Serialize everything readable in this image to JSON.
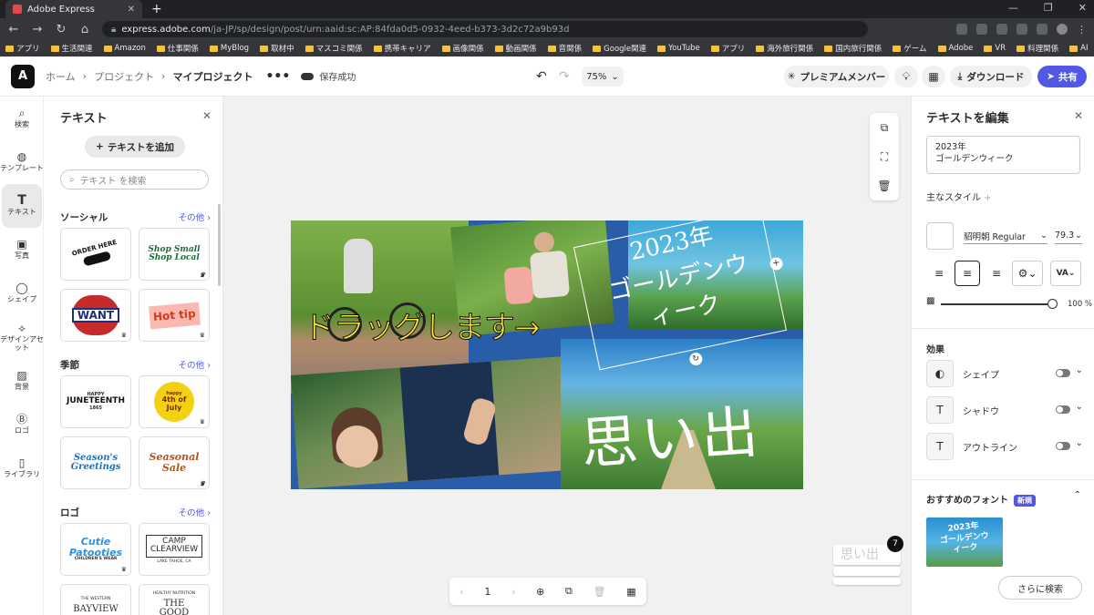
{
  "browser": {
    "tab_title": "Adobe Express",
    "url_host": "express.adobe.com",
    "url_path": "/ja-JP/sp/design/post/urn:aaid:sc:AP:84fda0d5-0932-4eed-b373-3d2c72a9b93d",
    "bookmarks": [
      "アプリ",
      "生活関連",
      "Amazon",
      "仕事関係",
      "MyBlog",
      "取材中",
      "マスコミ関係",
      "携帯キャリア",
      "画像関係",
      "動画関係",
      "音関係",
      "Google関連",
      "YouTube",
      "アプリ",
      "海外旅行関係",
      "国内旅行関係",
      "ゲーム",
      "Adobe",
      "VR",
      "料理関係",
      "AI"
    ]
  },
  "topbar": {
    "breadcrumb_home": "ホーム",
    "breadcrumb_projects": "プロジェクト",
    "breadcrumb_current": "マイプロジェクト",
    "more": "•••",
    "saved_status": "保存成功",
    "zoom": "75%",
    "premium": "プレミアムメンバー",
    "download": "ダウンロード",
    "share": "共有"
  },
  "rail": [
    {
      "icon": "search-icon",
      "label": "検索"
    },
    {
      "icon": "template-icon",
      "label": "テンプレート"
    },
    {
      "icon": "text-icon",
      "label": "テキスト"
    },
    {
      "icon": "photo-icon",
      "label": "写真"
    },
    {
      "icon": "shape-icon",
      "label": "シェイプ"
    },
    {
      "icon": "design-asset-icon",
      "label": "デザインアセット"
    },
    {
      "icon": "background-icon",
      "label": "背景"
    },
    {
      "icon": "logo-icon",
      "label": "ロゴ"
    },
    {
      "icon": "library-icon",
      "label": "ライブラリ"
    }
  ],
  "text_panel": {
    "title": "テキスト",
    "add_text": "テキストを追加",
    "search_placeholder": "テキスト を検索",
    "sections": [
      {
        "title": "ソーシャル",
        "more": "その他 ›"
      },
      {
        "title": "季節",
        "more": "その他 ›"
      },
      {
        "title": "ロゴ",
        "more": "その他 ›"
      }
    ],
    "thumbs": {
      "order_here": "ORDER HERE",
      "shop_small": "Shop Small Shop Local",
      "want": "WANT",
      "hot_tip": "Hot tip",
      "juneteenth_top": "HAPPY",
      "juneteenth": "JUNETEENTH",
      "juneteenth_year": "1865",
      "fourth_top": "happy",
      "fourth": "4th of July",
      "seasons": "Season's Greetings",
      "seasonal_sale": "Seasonal Sale",
      "cutie": "Cutie Patooties",
      "cutie_sub": "CHILDREN'S WEAR",
      "camp": "CAMP CLEARVIEW",
      "camp_sub": "LAKE TAHOE, CA",
      "western_top": "THE WESTERN",
      "bayview": "BAYVIEW",
      "good_food_top": "HEALTHY NUTRITION",
      "good_food": "THE GOOD FOOD"
    }
  },
  "canvas": {
    "headline_year": "2023年",
    "headline_main": "ゴールデンウ",
    "headline_tail": "ィーク",
    "memory": "思い出",
    "overlay": "ドラッグします→",
    "page_number": "1",
    "page_count": "7",
    "page_thumb_text": "思い出"
  },
  "right_panel": {
    "title": "テキストを編集",
    "text_value_line1": "2023年",
    "text_value_line2": "ゴールデンウィーク",
    "main_style": "主なスタイル",
    "font_name": "貂明朝 Regular",
    "font_size": "79.3",
    "opacity": "100 %",
    "effects_title": "効果",
    "effects": [
      "シェイプ",
      "シャドウ",
      "アウトライン"
    ],
    "recommended_fonts": "おすすめのフォント",
    "new_badge": "新規",
    "rec_thumb_line1": "2023年",
    "rec_thumb_line2": "ゴールデンウ",
    "rec_thumb_line3": "ィーク",
    "search_more": "さらに検索"
  },
  "colors": {
    "accent": "#5258e4",
    "overlay_text": "#f7e23a",
    "canvas_sky": "#2a5da8"
  }
}
